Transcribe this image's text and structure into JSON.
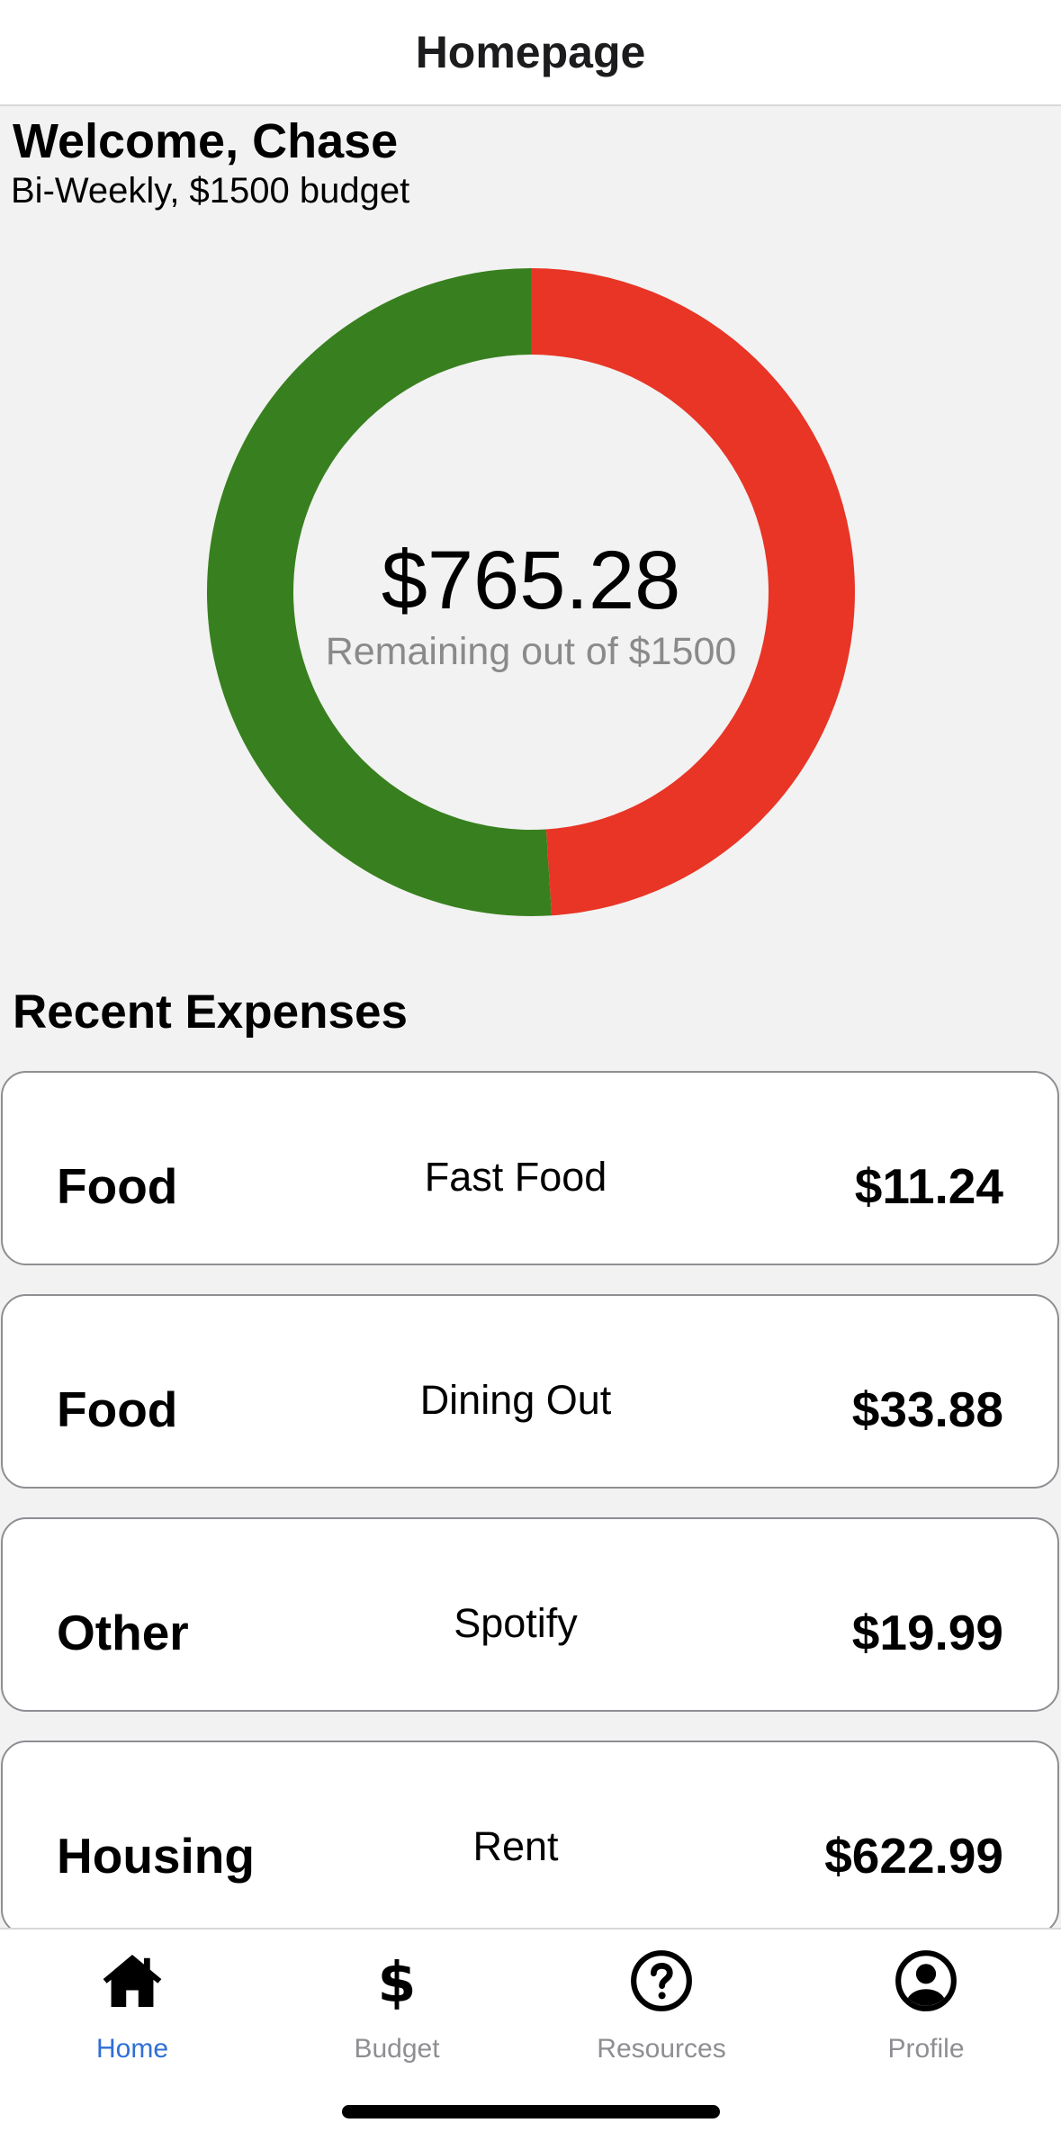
{
  "header": {
    "title": "Homepage"
  },
  "welcome": {
    "greeting": "Welcome, Chase",
    "subtitle": "Bi-Weekly, $1500 budget"
  },
  "budget_chart": {
    "remaining_amount": "$765.28",
    "remaining_label": "Remaining out of $1500",
    "total": 1500,
    "remaining": 765.28,
    "spent": 734.72,
    "colors": {
      "remaining": "#38801f",
      "spent": "#e83526"
    }
  },
  "recent_expenses": {
    "title": "Recent Expenses",
    "items": [
      {
        "category": "Food",
        "description": "Fast Food",
        "amount": "$11.24"
      },
      {
        "category": "Food",
        "description": "Dining Out",
        "amount": "$33.88"
      },
      {
        "category": "Other",
        "description": "Spotify",
        "amount": "$19.99"
      },
      {
        "category": "Housing",
        "description": "Rent",
        "amount": "$622.99"
      }
    ]
  },
  "tabs": [
    {
      "label": "Home",
      "icon": "home-icon",
      "active": true
    },
    {
      "label": "Budget",
      "icon": "dollar-icon",
      "active": false
    },
    {
      "label": "Resources",
      "icon": "help-circle-icon",
      "active": false
    },
    {
      "label": "Profile",
      "icon": "profile-icon",
      "active": false
    }
  ],
  "colors": {
    "accent": "#2f6fd6",
    "inactive": "#8e8e93"
  }
}
